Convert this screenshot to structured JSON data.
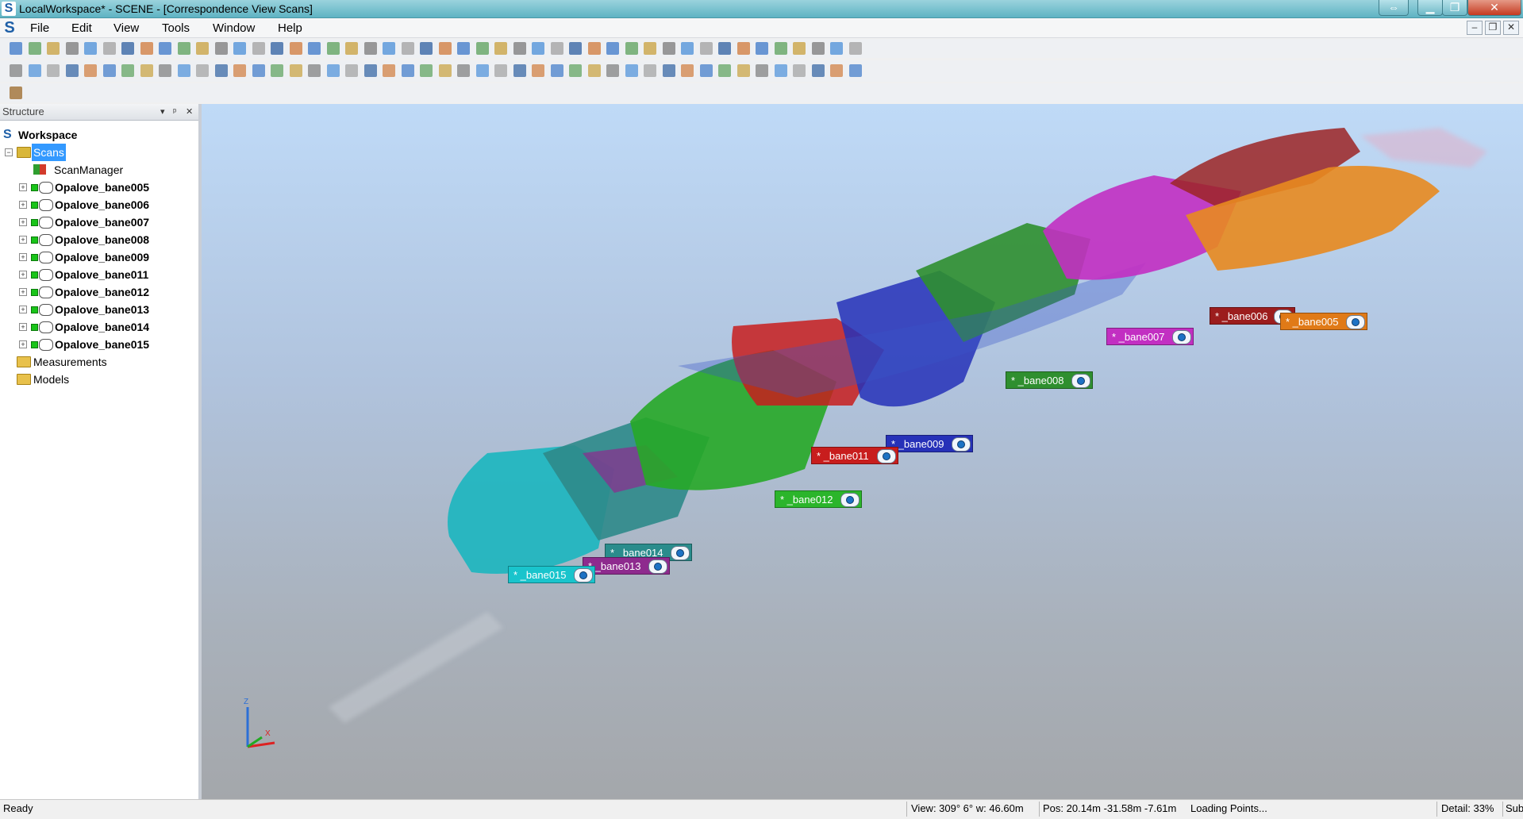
{
  "window": {
    "title": "LocalWorkspace* - SCENE - [Correspondence View Scans]",
    "logo": "S",
    "restore_glyph": "⇔",
    "minimize_glyph": "▁",
    "maximize_glyph": "❐",
    "close_glyph": "✕"
  },
  "menu": {
    "logo": "S",
    "items": [
      "File",
      "Edit",
      "View",
      "Tools",
      "Window",
      "Help"
    ],
    "mdi": [
      "–",
      "❐",
      "✕"
    ]
  },
  "panel": {
    "title": "Structure",
    "controls": [
      "▾",
      "ᵖ",
      "✕"
    ],
    "workspace": "Workspace",
    "scans": "Scans",
    "scan_manager": "ScanManager",
    "scan_items": [
      "Opalove_bane005",
      "Opalove_bane006",
      "Opalove_bane007",
      "Opalove_bane008",
      "Opalove_bane009",
      "Opalove_bane011",
      "Opalove_bane012",
      "Opalove_bane013",
      "Opalove_bane014",
      "Opalove_bane015"
    ],
    "measurements": "Measurements",
    "models": "Models"
  },
  "viewport": {
    "labels": [
      {
        "text": "* _bane006",
        "color": "#9c1d1d"
      },
      {
        "text": "* _bane005",
        "color": "#e07a17"
      },
      {
        "text": "* _bane007",
        "color": "#c22fc2"
      },
      {
        "text": "* _bane008",
        "color": "#2f8f2f"
      },
      {
        "text": "* _bane009",
        "color": "#2631b8"
      },
      {
        "text": "* _bane011",
        "color": "#c81d1d"
      },
      {
        "text": "* _bane012",
        "color": "#2bb52b"
      },
      {
        "text": "* _bane014",
        "color": "#2a8c8c"
      },
      {
        "text": "* _bane013",
        "color": "#8e2a8e"
      },
      {
        "text": "* _bane015",
        "color": "#19c4cc"
      }
    ],
    "axes": {
      "z": "Z",
      "x": "X"
    }
  },
  "status": {
    "ready": "Ready",
    "view": "View: 309° 6° w: 46.60m",
    "pos": "Pos: 20.14m -31.58m -7.61m",
    "loading": "Loading Points...",
    "detail": "Detail:  33%",
    "sub": "Sub"
  }
}
